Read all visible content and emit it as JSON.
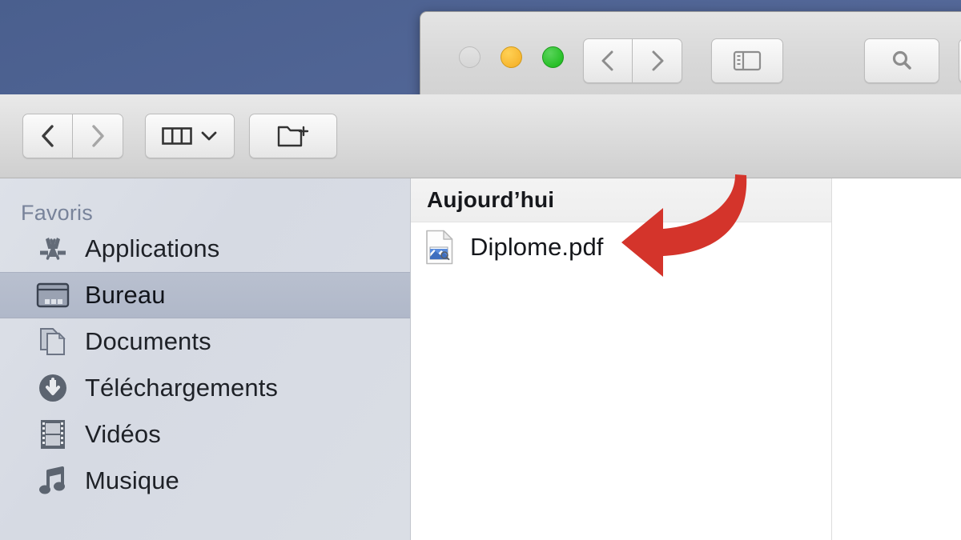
{
  "desktop": {
    "background_color_top": "#4a5f8e",
    "background_color_bottom": "#5d71a1"
  },
  "background_window": {
    "traffic_lights": [
      {
        "name": "close",
        "state": "disabled",
        "color": "#dcdcdc"
      },
      {
        "name": "minimize",
        "state": "enabled",
        "color": "#f7b731"
      },
      {
        "name": "zoom",
        "state": "enabled",
        "color": "#28c028"
      }
    ],
    "toolbar": {
      "back_label": "‹",
      "forward_label": "›",
      "sidebar_toggle_name": "sidebar-toggle",
      "search_name": "search"
    }
  },
  "main_window": {
    "toolbar": {
      "back_label": "‹",
      "forward_label": "›",
      "back_enabled": true,
      "forward_enabled": false,
      "view_mode": "column",
      "view_chevron": "⌄",
      "new_folder_label": "new-folder"
    },
    "sidebar": {
      "header": "Favoris",
      "selected": "Bureau",
      "items": [
        {
          "label": "Applications",
          "icon": "applications-icon",
          "selected": false
        },
        {
          "label": "Bureau",
          "icon": "desktop-icon",
          "selected": true
        },
        {
          "label": "Documents",
          "icon": "documents-icon",
          "selected": false
        },
        {
          "label": "Téléchargements",
          "icon": "downloads-icon",
          "selected": false
        },
        {
          "label": "Vidéos",
          "icon": "movies-icon",
          "selected": false
        },
        {
          "label": "Musique",
          "icon": "music-icon",
          "selected": false
        }
      ]
    },
    "file_list": {
      "group_header": "Aujourd’hui",
      "files": [
        {
          "name": "Diplome.pdf",
          "icon": "pdf-document-icon"
        }
      ]
    }
  },
  "annotation": {
    "type": "curved-arrow",
    "direction": "left",
    "color": "#d4342b",
    "points_at": "Diplome.pdf"
  }
}
